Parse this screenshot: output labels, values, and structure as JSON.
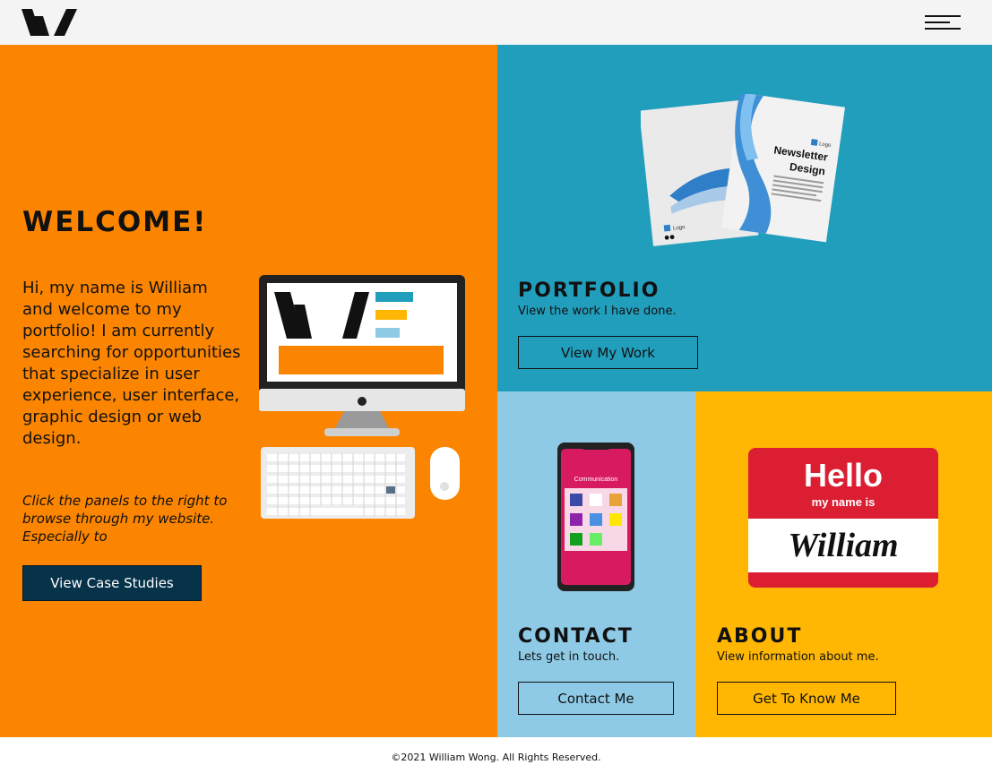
{
  "colors": {
    "header_bg": "#f4f4f4",
    "welcome_bg": "#fb8500",
    "portfolio_bg": "#219ebc",
    "contact_bg": "#8ecae6",
    "about_bg": "#ffb703",
    "dark_button_bg": "#06324a"
  },
  "header": {
    "logo_icon": "w-logo-icon",
    "menu_icon": "hamburger-menu-icon"
  },
  "welcome": {
    "title": "WELCOME!",
    "intro": "Hi, my name is William and welcome to my portfolio! I am currently searching for opportunities that specialize in user experience, user interface, graphic design or web design.",
    "note": "Click the panels to the right to browse through my website. Especially to",
    "button_label": "View Case Studies",
    "illustration_icon": "desktop-computer-icon"
  },
  "portfolio": {
    "title": "PORTFOLIO",
    "subtitle": "View the work I have done.",
    "button_label": "View My Work",
    "illustration": {
      "logo_text": "Logo",
      "heading_line1": "Newsletter",
      "heading_line2": "Design"
    }
  },
  "contact": {
    "title": "CONTACT",
    "subtitle": "Lets get in touch.",
    "button_label": "Contact Me",
    "phone_screen_title": "Communication"
  },
  "about": {
    "title": "ABOUT",
    "subtitle": "View information about me.",
    "button_label": "Get To Know Me",
    "name_tag": {
      "hello": "Hello",
      "my_name_is": "my name is",
      "name": "William"
    }
  },
  "footer": {
    "copyright": "©2021 William Wong. All Rights Reserved."
  }
}
